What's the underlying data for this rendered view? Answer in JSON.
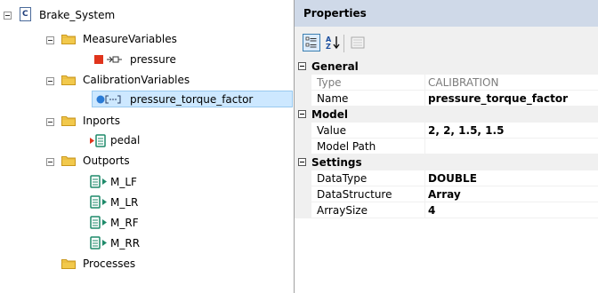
{
  "tree": {
    "root": {
      "label": "Brake_System",
      "icon": "model-icon"
    },
    "measure_variables": {
      "label": "MeasureVariables",
      "icon": "folder-icon"
    },
    "pressure": {
      "label": "pressure",
      "icon": "measure-variable-icon"
    },
    "calibration_variables": {
      "label": "CalibrationVariables",
      "icon": "folder-icon"
    },
    "pressure_torque_factor": {
      "label": "pressure_torque_factor",
      "icon": "calibration-variable-icon",
      "selected": true
    },
    "inports": {
      "label": "Inports",
      "icon": "folder-icon"
    },
    "pedal": {
      "label": "pedal",
      "icon": "inport-icon"
    },
    "outports": {
      "label": "Outports",
      "icon": "folder-icon"
    },
    "outport_items": [
      {
        "label": "M_LF",
        "icon": "outport-icon"
      },
      {
        "label": "M_LR",
        "icon": "outport-icon"
      },
      {
        "label": "M_RF",
        "icon": "outport-icon"
      },
      {
        "label": "M_RR",
        "icon": "outport-icon"
      }
    ],
    "processes": {
      "label": "Processes",
      "icon": "folder-icon"
    }
  },
  "properties": {
    "title": "Properties",
    "toolbar": {
      "categorized": "categorized-view-icon",
      "alphabetical": "alphabetical-sort-icon",
      "property_pages": "property-pages-icon"
    },
    "categories": [
      {
        "label": "General",
        "rows": [
          {
            "name": "Type",
            "value": "CALIBRATION",
            "readonly": true
          },
          {
            "name": "Name",
            "value": "pressure_torque_factor",
            "readonly": false
          }
        ]
      },
      {
        "label": "Model",
        "rows": [
          {
            "name": "Value",
            "value": "2, 2, 1.5, 1.5",
            "readonly": false
          },
          {
            "name": "Model Path",
            "value": "",
            "readonly": false
          }
        ]
      },
      {
        "label": "Settings",
        "rows": [
          {
            "name": "DataType",
            "value": "DOUBLE",
            "readonly": false
          },
          {
            "name": "DataStructure",
            "value": "Array",
            "readonly": false
          },
          {
            "name": "ArraySize",
            "value": "4",
            "readonly": false
          }
        ]
      }
    ]
  },
  "colors": {
    "header_bg": "#cfd9e8",
    "selection_bg": "#cde8ff",
    "folder": "#e8b923",
    "measure": "#e0341c",
    "calibration": "#2a7bd6",
    "port": "#1e8a6a"
  }
}
